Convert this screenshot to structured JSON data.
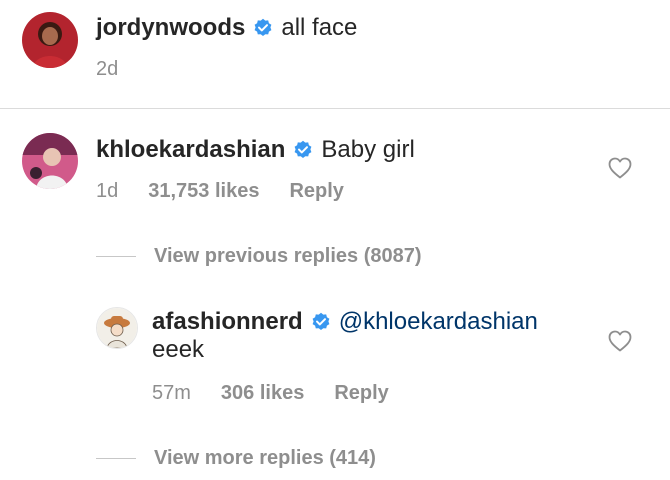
{
  "caption": {
    "username": "jordynwoods",
    "text": "all face",
    "time": "2d"
  },
  "comment": {
    "username": "khloekardashian",
    "text": "Baby girl",
    "time": "1d",
    "likes": "31,753 likes",
    "reply_label": "Reply"
  },
  "view_previous": "View previous replies (8087)",
  "reply": {
    "username": "afashionnerd",
    "mention": "@khloekardashian",
    "text": "eeek",
    "time": "57m",
    "likes": "306 likes",
    "reply_label": "Reply"
  },
  "view_more": "View more replies (414)",
  "colors": {
    "verified": "#3897f0",
    "mention": "#003569",
    "meta": "#8e8e8e",
    "text": "#262626"
  },
  "icons": [
    "verified-badge-icon",
    "heart-icon"
  ]
}
